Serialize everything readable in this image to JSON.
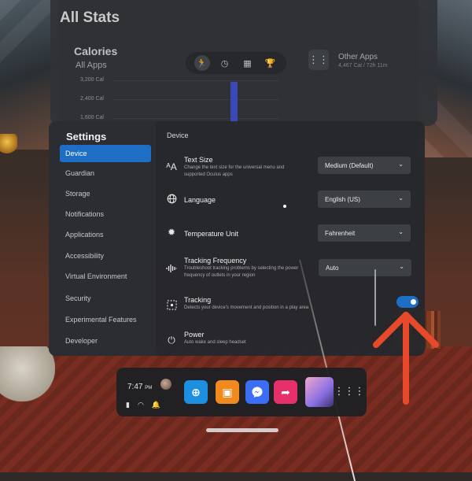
{
  "stats": {
    "title": "All Stats",
    "calories_title": "Calories",
    "calories_sub": "All Apps",
    "y_labels": [
      "3,200 Cal",
      "2,400 Cal",
      "1,600 Cal"
    ],
    "nav_icons": [
      "running-person-icon",
      "clock-icon",
      "calendar-icon",
      "trophy-icon"
    ],
    "other_apps_label": "Other Apps",
    "other_apps_sub": "4,467 Cal / 72h 11m"
  },
  "settings": {
    "title": "Settings",
    "sidebar": [
      {
        "label": "Device",
        "active": true
      },
      {
        "label": "Guardian"
      },
      {
        "label": "Storage"
      },
      {
        "label": "Notifications"
      },
      {
        "label": "Applications"
      },
      {
        "label": "Accessibility"
      },
      {
        "label": "Virtual Environment"
      },
      {
        "label": "Security"
      },
      {
        "label": "Experimental Features"
      },
      {
        "label": "Developer"
      }
    ],
    "section_title": "Device",
    "rows": {
      "text_size": {
        "label": "Text Size",
        "desc": "Change the text size for the universal menu and supported Oculus apps",
        "value": "Medium (Default)",
        "icon": "text-size-icon"
      },
      "language": {
        "label": "Language",
        "value": "English (US)",
        "icon": "globe-icon"
      },
      "temperature": {
        "label": "Temperature Unit",
        "value": "Fahrenheit",
        "icon": "sun-icon"
      },
      "tracking_frequency": {
        "label": "Tracking Frequency",
        "desc": "Troubleshoot tracking problems by selecting the power frequency of outlets in your region",
        "value": "Auto",
        "icon": "waveform-icon"
      },
      "tracking": {
        "label": "Tracking",
        "desc": "Detects your device's movement and position in a play area",
        "enabled": true,
        "icon": "tracking-icon"
      },
      "power": {
        "label": "Power",
        "desc": "Auto wake and sleep headset",
        "icon": "power-icon"
      }
    }
  },
  "taskbar": {
    "time": "7:47",
    "ampm": "PM",
    "apps": [
      "store-icon",
      "shopping-bag-icon",
      "messenger-icon",
      "share-icon"
    ],
    "grid_icon": "app-grid-icon"
  },
  "colors": {
    "accent": "#1f6ec6",
    "annotation_arrow": "#e8492a"
  }
}
